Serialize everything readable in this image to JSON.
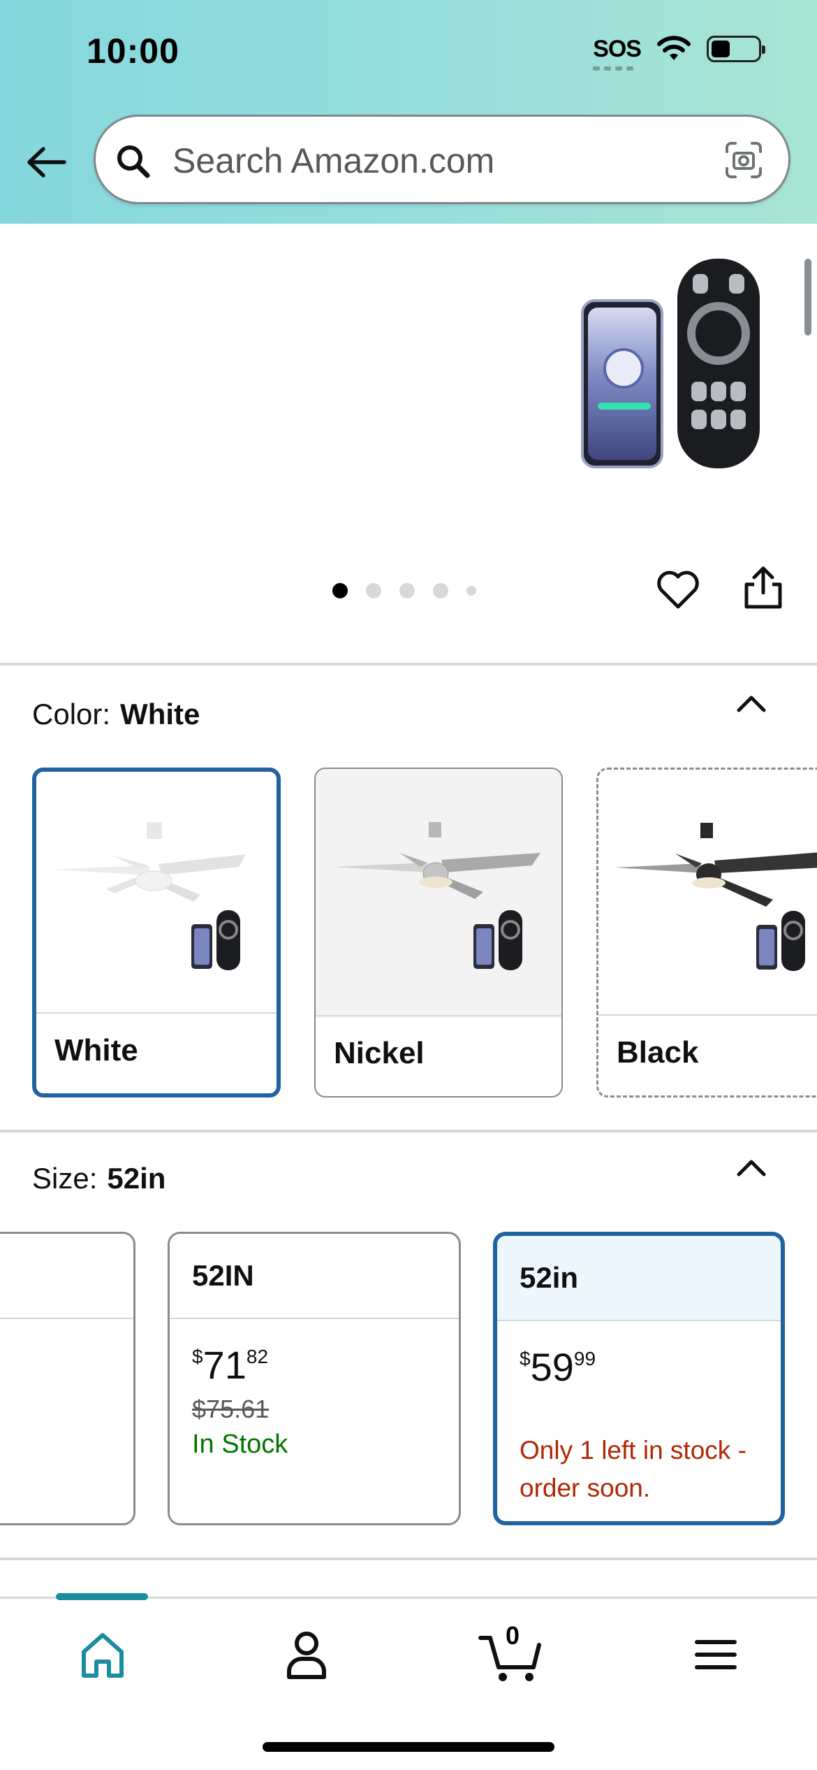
{
  "status_bar": {
    "time": "10:00",
    "sos": "SOS",
    "battery_level": 0.35
  },
  "search": {
    "placeholder": "Search Amazon.com"
  },
  "gallery": {
    "image_count": 5,
    "active_index": 0
  },
  "color": {
    "label": "Color:",
    "selected": "White",
    "options": [
      {
        "name": "White",
        "selected": true
      },
      {
        "name": "Nickel",
        "selected": false
      },
      {
        "name": "Black",
        "selected": false
      }
    ]
  },
  "size": {
    "label": "Size:",
    "selected": "52in",
    "options": [
      {
        "name": "",
        "partial": true
      },
      {
        "name": "52IN",
        "price_whole": "71",
        "price_fraction": "82",
        "currency": "$",
        "list_price": "$75.61",
        "availability": "In Stock"
      },
      {
        "name": "52in",
        "price_whole": "59",
        "price_fraction": "99",
        "currency": "$",
        "availability": "Only 1 left in stock - order soon.",
        "selected": true
      }
    ]
  },
  "bottom_nav": {
    "items": [
      "home",
      "account",
      "cart",
      "menu"
    ],
    "active": "home",
    "cart_count": "0"
  },
  "colors": {
    "header_start": "#84d7dd",
    "header_end": "#a8e4d4",
    "selected_border": "#2162a1",
    "in_stock": "#007600",
    "low_stock": "#b12704",
    "nav_accent": "#1a8da2"
  }
}
